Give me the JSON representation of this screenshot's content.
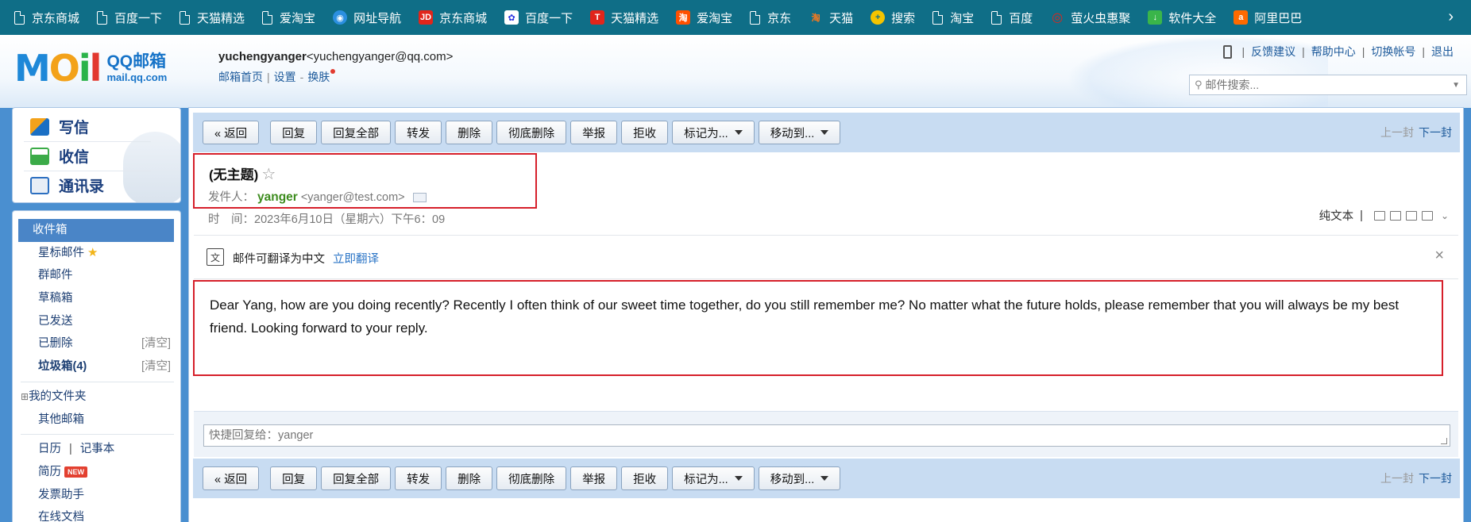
{
  "bookmarks": {
    "items": [
      {
        "label": "京东商城",
        "icon": "page-icon",
        "color": "#ffffff"
      },
      {
        "label": "百度一下",
        "icon": "page-icon",
        "color": "#ffffff"
      },
      {
        "label": "天猫精选",
        "icon": "page-icon",
        "color": "#ffffff"
      },
      {
        "label": "爱淘宝",
        "icon": "page-icon",
        "color": "#ffffff"
      },
      {
        "label": "网址导航",
        "icon": "wifi-icon",
        "color": "#2b8fe0"
      },
      {
        "label": "京东商城",
        "icon": "jd-icon",
        "color": "#e1251b"
      },
      {
        "label": "百度一下",
        "icon": "baidu-icon",
        "color": "#2932e1"
      },
      {
        "label": "天猫精选",
        "icon": "tmall-icon",
        "color": "#e1251b"
      },
      {
        "label": "爱淘宝",
        "icon": "taobao-icon",
        "color": "#ff5000"
      },
      {
        "label": "京东",
        "icon": "page-icon",
        "color": "#ffffff"
      },
      {
        "label": "天猫",
        "icon": "tmall-cat-icon",
        "color": "#ff5000"
      },
      {
        "label": "搜索",
        "icon": "search-plus-icon",
        "color": "#f5c400"
      },
      {
        "label": "淘宝",
        "icon": "page-icon",
        "color": "#ffffff"
      },
      {
        "label": "百度",
        "icon": "page-icon",
        "color": "#ffffff"
      },
      {
        "label": "萤火虫惠聚",
        "icon": "firefly-icon",
        "color": "#e1251b"
      },
      {
        "label": "软件大全",
        "icon": "download-icon",
        "color": "#3ab54a"
      },
      {
        "label": "阿里巴巴",
        "icon": "alibaba-icon",
        "color": "#ff6a00"
      }
    ]
  },
  "header": {
    "logo_mail": "MOil",
    "logo_title": "QQ邮箱",
    "logo_domain": "mail.qq.com",
    "user_nick": "yuchengyanger",
    "user_email": "<yuchengyanger@qq.com>",
    "link_home": "邮箱首页",
    "link_settings": "设置",
    "link_skin": "换肤",
    "feedback": "反馈建议",
    "help": "帮助中心",
    "switch_account": "切换帐号",
    "logout": "退出",
    "search_placeholder": "邮件搜索..."
  },
  "left": {
    "write": "写信",
    "receive": "收信",
    "contacts": "通讯录",
    "inbox": "收件箱",
    "starred": "星标邮件",
    "group": "群邮件",
    "drafts": "草稿箱",
    "sent": "已发送",
    "deleted": "已删除",
    "deleted_clear": "[清空]",
    "spam": "垃圾箱(4)",
    "spam_clear": "[清空]",
    "my_folders": "我的文件夹",
    "other_mailbox": "其他邮箱",
    "calendar": "日历",
    "notes": "记事本",
    "resume": "简历",
    "new_badge": "NEW",
    "invoice": "发票助手",
    "online_docs": "在线文档"
  },
  "toolbar": {
    "back": "« 返回",
    "reply": "回复",
    "reply_all": "回复全部",
    "forward": "转发",
    "delete": "删除",
    "delete_perm": "彻底删除",
    "report": "举报",
    "reject": "拒收",
    "mark_as": "标记为...",
    "move_to": "移动到...",
    "prev": "上一封",
    "next": "下一封"
  },
  "mail": {
    "subject": "(无主题)",
    "sender_label": "发件人：",
    "sender_name": "yanger",
    "sender_email": "<yanger@test.com>",
    "time_label": "时　间：",
    "time_value": "2023年6月10日（星期六）下午6：09",
    "plain_text": "纯文本",
    "translate_text": "邮件可翻译为中文",
    "translate_link": "立即翻译",
    "body": "Dear Yang, how are you doing recently? Recently I often think of our sweet time together, do you still remember me? No matter what the future holds, please remember that you will always be my best friend. Looking forward to your reply.",
    "reply_placeholder": "快捷回复给：yanger"
  },
  "colors": {
    "bookmark_bar": "#0f6e87",
    "frame_blue": "#4a8fd0",
    "active_nav": "#4a85c7",
    "highlight_red": "#d61f2a",
    "sender_green": "#3d8c1e"
  }
}
